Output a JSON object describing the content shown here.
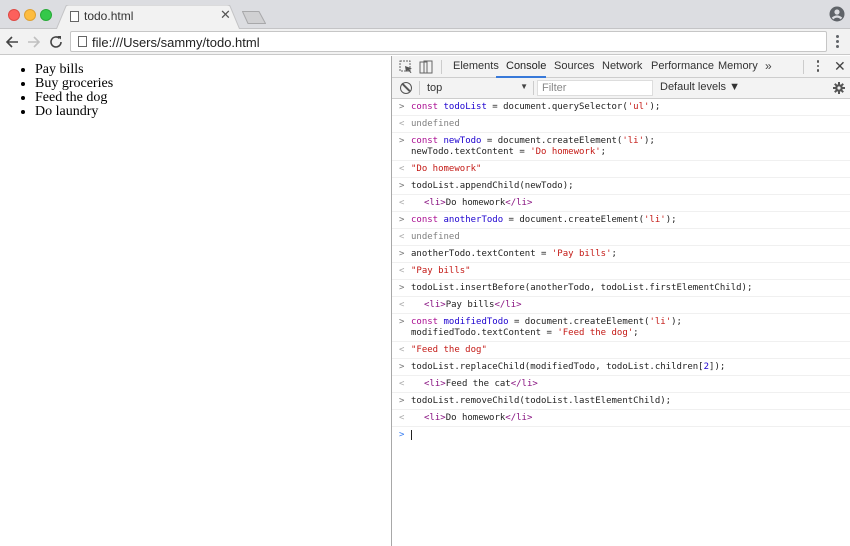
{
  "browser": {
    "tab_title": "todo.html",
    "url": "file:///Users/sammy/todo.html"
  },
  "page": {
    "todo_items": [
      "Pay bills",
      "Buy groceries",
      "Feed the dog",
      "Do laundry"
    ]
  },
  "devtools": {
    "tabs": [
      "Elements",
      "Console",
      "Sources",
      "Network",
      "Performance",
      "Memory"
    ],
    "active_tab": "Console",
    "more_tabs_label": "»",
    "context": "top",
    "filter_placeholder": "Filter",
    "levels_label": "Default levels ▼",
    "accent_color": "#3879d9"
  },
  "console": {
    "entries": [
      {
        "type": "input",
        "lines": [
          [
            [
              "kw",
              "const "
            ],
            [
              "var",
              "todoList"
            ],
            [
              "",
              "  = document.querySelector("
            ],
            [
              "str",
              "'ul'"
            ],
            [
              "",
              ");"
            ]
          ]
        ]
      },
      {
        "type": "output",
        "lines": [
          [
            [
              "undef",
              "undefined"
            ]
          ]
        ]
      },
      {
        "type": "input",
        "lines": [
          [
            [
              "kw",
              "const "
            ],
            [
              "var",
              "newTodo"
            ],
            [
              "",
              "  = document.createElement("
            ],
            [
              "str",
              "'li'"
            ],
            [
              "",
              ");"
            ]
          ],
          [
            [
              "",
              "newTodo.textContent = "
            ],
            [
              "str",
              "'Do homework'"
            ],
            [
              "",
              ";"
            ]
          ]
        ]
      },
      {
        "type": "output",
        "lines": [
          [
            [
              "str",
              "\"Do homework\""
            ]
          ]
        ]
      },
      {
        "type": "input",
        "lines": [
          [
            [
              "",
              "todoList.appendChild(newTodo);"
            ]
          ]
        ]
      },
      {
        "type": "element",
        "lines": [
          [
            [
              "tag",
              "<li>"
            ],
            [
              "eltext",
              "Do homework"
            ],
            [
              "tag",
              "</li>"
            ]
          ]
        ]
      },
      {
        "type": "input",
        "lines": [
          [
            [
              "kw",
              "const "
            ],
            [
              "var",
              "anotherTodo"
            ],
            [
              "",
              "  = document.createElement("
            ],
            [
              "str",
              "'li'"
            ],
            [
              "",
              ");"
            ]
          ]
        ]
      },
      {
        "type": "output",
        "lines": [
          [
            [
              "undef",
              "undefined"
            ]
          ]
        ]
      },
      {
        "type": "input",
        "lines": [
          [
            [
              "",
              "anotherTodo.textContent = "
            ],
            [
              "str",
              "'Pay bills'"
            ],
            [
              "",
              ";"
            ]
          ]
        ]
      },
      {
        "type": "output",
        "lines": [
          [
            [
              "str",
              "\"Pay bills\""
            ]
          ]
        ]
      },
      {
        "type": "input",
        "lines": [
          [
            [
              "",
              "todoList.insertBefore(anotherTodo, todoList.firstElementChild);"
            ]
          ]
        ]
      },
      {
        "type": "element",
        "lines": [
          [
            [
              "tag",
              "<li>"
            ],
            [
              "eltext",
              "Pay bills"
            ],
            [
              "tag",
              "</li>"
            ]
          ]
        ]
      },
      {
        "type": "input",
        "lines": [
          [
            [
              "kw",
              "const "
            ],
            [
              "var",
              "modifiedTodo"
            ],
            [
              "",
              "  = document.createElement("
            ],
            [
              "str",
              "'li'"
            ],
            [
              "",
              ");"
            ]
          ],
          [
            [
              "",
              "modifiedTodo.textContent = "
            ],
            [
              "str",
              "'Feed the dog'"
            ],
            [
              "",
              ";"
            ]
          ]
        ]
      },
      {
        "type": "output",
        "lines": [
          [
            [
              "str",
              "\"Feed the dog\""
            ]
          ]
        ]
      },
      {
        "type": "input",
        "lines": [
          [
            [
              "",
              "todoList.replaceChild(modifiedTodo, todoList.children["
            ],
            [
              "num",
              "2"
            ],
            [
              "",
              "]);"
            ]
          ]
        ]
      },
      {
        "type": "element",
        "lines": [
          [
            [
              "tag",
              "<li>"
            ],
            [
              "eltext",
              "Feed the cat"
            ],
            [
              "tag",
              "</li>"
            ]
          ]
        ]
      },
      {
        "type": "input",
        "lines": [
          [
            [
              "",
              "todoList.removeChild(todoList.lastElementChild);"
            ]
          ]
        ]
      },
      {
        "type": "element",
        "lines": [
          [
            [
              "tag",
              "<li>"
            ],
            [
              "eltext",
              "Do homework"
            ],
            [
              "tag",
              "</li>"
            ]
          ]
        ]
      }
    ],
    "prompt_symbol": ">",
    "input_symbol": ">",
    "output_symbol": "<"
  }
}
